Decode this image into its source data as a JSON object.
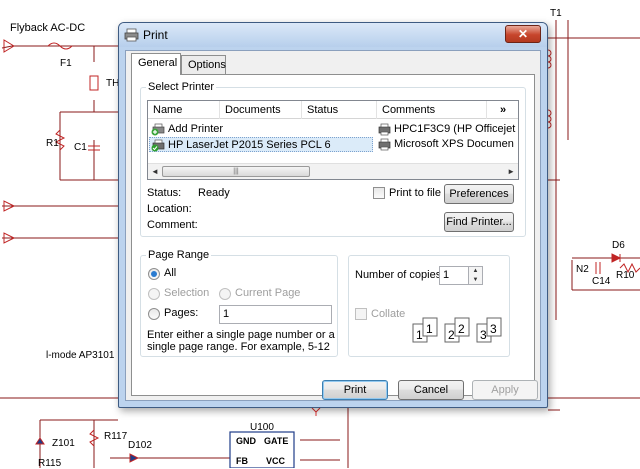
{
  "background": {
    "title": "Flyback AC-DC",
    "labels": [
      "F1",
      "TH",
      "R1",
      "C1",
      "T1",
      "D6",
      "N2",
      "C14",
      "R10",
      "l-mode AP3101",
      "U100",
      "R117",
      "Z101",
      "D102",
      "R115",
      "GND",
      "GATE",
      "FB",
      "VCC"
    ]
  },
  "dialog": {
    "title": "Print",
    "close_label": "✕",
    "tabs": [
      "General",
      "Options"
    ],
    "select_printer": {
      "legend": "Select Printer",
      "columns": [
        "Name",
        "Documents",
        "Status",
        "Comments",
        "»"
      ],
      "items": [
        {
          "label": "Add Printer",
          "icon": "add-printer-icon"
        },
        {
          "label": "HPC1F3C9 (HP Officejet",
          "icon": "printer-icon"
        },
        {
          "label": "HP LaserJet P2015 Series PCL 6",
          "icon": "default-printer-icon"
        },
        {
          "label": "Microsoft XPS Documen",
          "icon": "printer-icon"
        }
      ],
      "scroll_left": "◄",
      "scroll_right": "►",
      "thumb_grip": "|||",
      "status_label": "Status:",
      "status_value": "Ready",
      "location_label": "Location:",
      "comment_label": "Comment:",
      "print_to_file": "Print to file",
      "preferences": "Preferences",
      "find_printer": "Find Printer..."
    },
    "page_range": {
      "legend": "Page Range",
      "all": "All",
      "selection": "Selection",
      "current_page": "Current Page",
      "pages": "Pages:",
      "pages_value": "1",
      "hint": "Enter either a single page number or a single page range.  For example, 5-12"
    },
    "copies": {
      "label": "Number of copies:",
      "value": "1",
      "collate": "Collate",
      "docs": [
        "1",
        "1",
        "2",
        "2",
        "3",
        "3"
      ]
    },
    "buttons": {
      "print": "Print",
      "cancel": "Cancel",
      "apply": "Apply"
    }
  }
}
